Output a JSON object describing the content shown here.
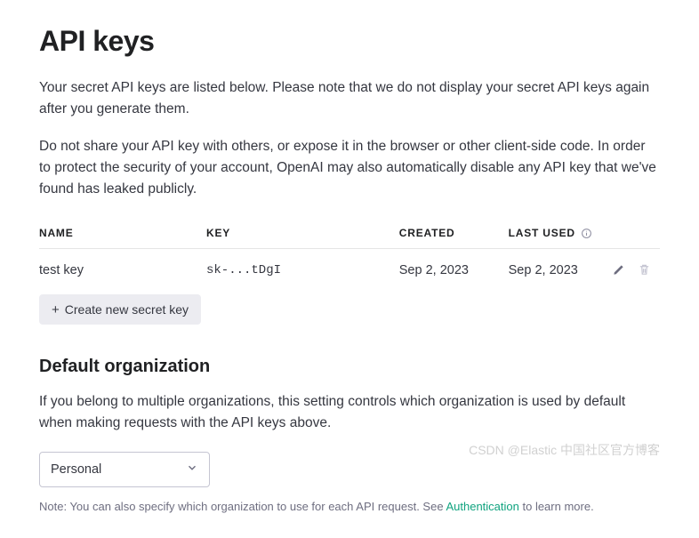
{
  "title": "API keys",
  "intro1": "Your secret API keys are listed below. Please note that we do not display your secret API keys again after you generate them.",
  "intro2": "Do not share your API key with others, or expose it in the browser or other client-side code. In order to protect the security of your account, OpenAI may also automatically disable any API key that we've found has leaked publicly.",
  "table": {
    "headers": {
      "name": "NAME",
      "key": "KEY",
      "created": "CREATED",
      "lastUsed": "LAST USED"
    },
    "row": {
      "name": "test key",
      "key": "sk-...tDgI",
      "created": "Sep 2, 2023",
      "lastUsed": "Sep 2, 2023"
    }
  },
  "createBtn": "Create new secret key",
  "orgHeading": "Default organization",
  "orgDesc": "If you belong to multiple organizations, this setting controls which organization is used by default when making requests with the API keys above.",
  "orgSelected": "Personal",
  "note": {
    "prefix": "Note: You can also specify which organization to use for each API request. See ",
    "link": "Authentication",
    "suffix": " to learn more."
  },
  "watermark": "CSDN @Elastic 中国社区官方博客"
}
